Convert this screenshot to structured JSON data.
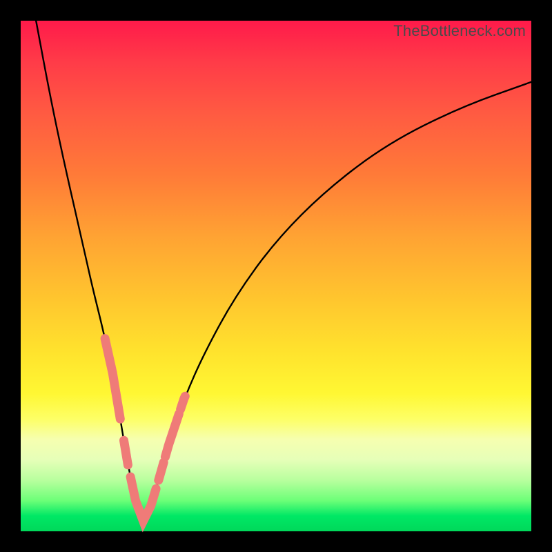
{
  "watermark": "TheBottleneck.com",
  "chart_data": {
    "type": "line",
    "title": "",
    "xlabel": "",
    "ylabel": "",
    "xlim": [
      0,
      100
    ],
    "ylim": [
      0,
      100
    ],
    "note": "Axes are unlabeled in the source image; x/y are normalized 0–100. V-shaped bottleneck curve with minimum near x≈24. Pink segments mark highlighted data ranges on the curve.",
    "series": [
      {
        "name": "bottleneck-curve",
        "x": [
          3,
          6,
          9,
          12,
          14,
          16,
          18,
          19.5,
          21,
          22.5,
          24,
          25.5,
          27,
          29,
          32,
          36,
          42,
          50,
          60,
          72,
          86,
          100
        ],
        "y": [
          100,
          84,
          70,
          57,
          48,
          40,
          31,
          22,
          13,
          6,
          2,
          5,
          10,
          17,
          26,
          35,
          46,
          57,
          67,
          76,
          83,
          88
        ]
      }
    ],
    "highlight_segments": {
      "description": "Thick salmon/pink stroke ranges overlaid on the curve near the trough.",
      "color": "#ef7b78",
      "ranges_x": [
        [
          16.5,
          19.5
        ],
        [
          20.2,
          21.0
        ],
        [
          21.5,
          23.0
        ],
        [
          23.0,
          26.5
        ],
        [
          27.0,
          28.0
        ],
        [
          28.3,
          31.0
        ],
        [
          31.3,
          32.2
        ]
      ]
    }
  },
  "colors": {
    "frame": "#000000",
    "curve": "#000000",
    "highlight": "#ef7b78",
    "watermark": "#4a4a4a"
  }
}
